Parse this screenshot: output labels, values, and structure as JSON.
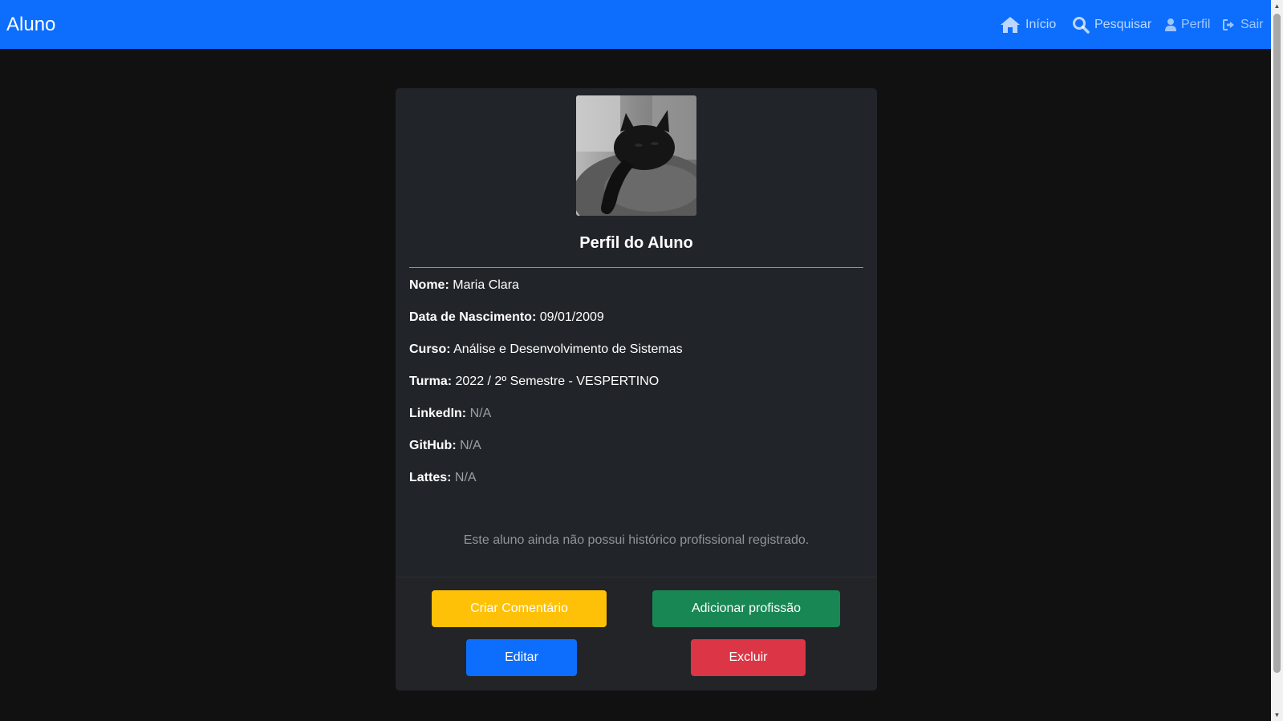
{
  "navbar": {
    "brand": "Aluno",
    "links": [
      {
        "label": "Início",
        "icon": "home-icon"
      },
      {
        "label": "Pesquisar",
        "icon": "search-icon"
      },
      {
        "label": "Perfil",
        "icon": "user-icon"
      },
      {
        "label": "Sair",
        "icon": "sign-out-icon"
      }
    ]
  },
  "profile": {
    "title": "Perfil do Aluno",
    "fields": [
      {
        "label": "Nome:",
        "value": "Maria Clara"
      },
      {
        "label": "Data de Nascimento:",
        "value": "09/01/2009"
      },
      {
        "label": "Curso:",
        "value": "Análise e Desenvolvimento de Sistemas"
      },
      {
        "label": "Turma:",
        "value": "2022 / 2º Semestre - VESPERTINO"
      },
      {
        "label": "LinkedIn:",
        "value": "N/A"
      },
      {
        "label": "GitHub:",
        "value": "N/A"
      },
      {
        "label": "Lattes:",
        "value": "N/A"
      }
    ],
    "empty_history": "Este aluno ainda não possui histórico profissional registrado."
  },
  "actions": {
    "comment": "Criar Comentário",
    "add_profession": "Adicionar profissão",
    "edit": "Editar",
    "delete": "Excluir"
  },
  "colors": {
    "primary": "#0d6efd",
    "warning": "#ffc107",
    "success": "#198754",
    "danger": "#dc3545",
    "card": "#212529",
    "background": "#111111"
  }
}
